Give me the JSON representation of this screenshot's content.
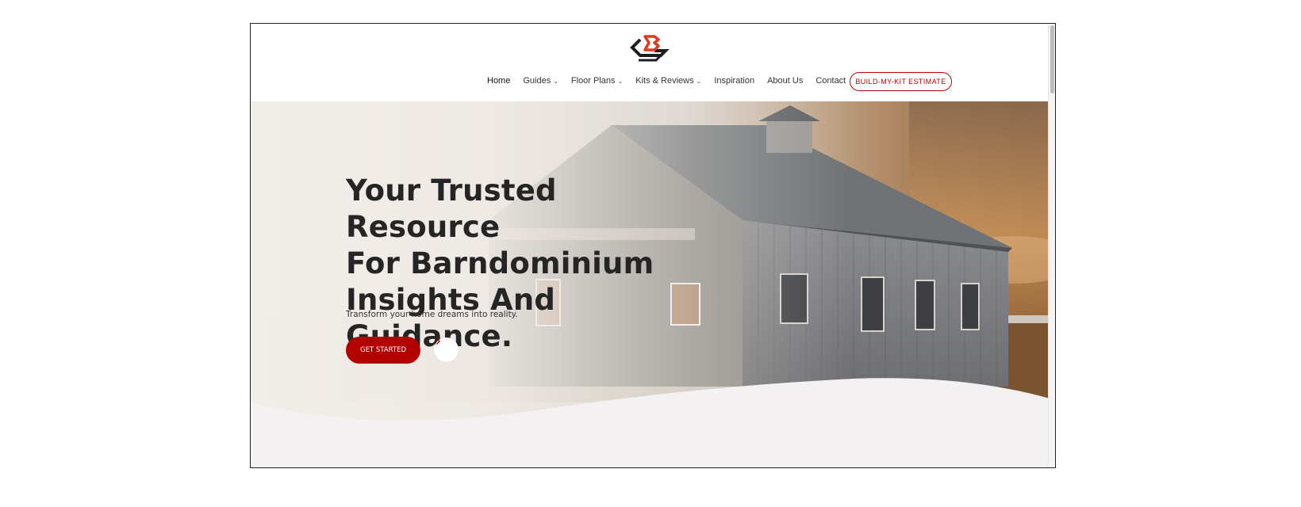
{
  "nav": {
    "items": [
      {
        "label": "Home",
        "dropdown": false,
        "active": true
      },
      {
        "label": "Guides",
        "dropdown": true
      },
      {
        "label": "Floor Plans",
        "dropdown": true
      },
      {
        "label": "Kits & Reviews",
        "dropdown": true
      },
      {
        "label": "Inspiration",
        "dropdown": false
      },
      {
        "label": "About Us",
        "dropdown": false
      },
      {
        "label": "Contact",
        "dropdown": false
      }
    ],
    "cta_label": "BUILD-MY-KIT ESTIMATE"
  },
  "hero": {
    "title_lines": [
      "Your Trusted Resource",
      "For Barndominium",
      "Insights And Guidance."
    ],
    "subtitle": "Transform your home dreams into reality.",
    "primary_button": "GET STARTED",
    "arrow_icon": "chevron-right-icon"
  },
  "colors": {
    "brand_red": "#b30000",
    "heading": "#252525"
  }
}
